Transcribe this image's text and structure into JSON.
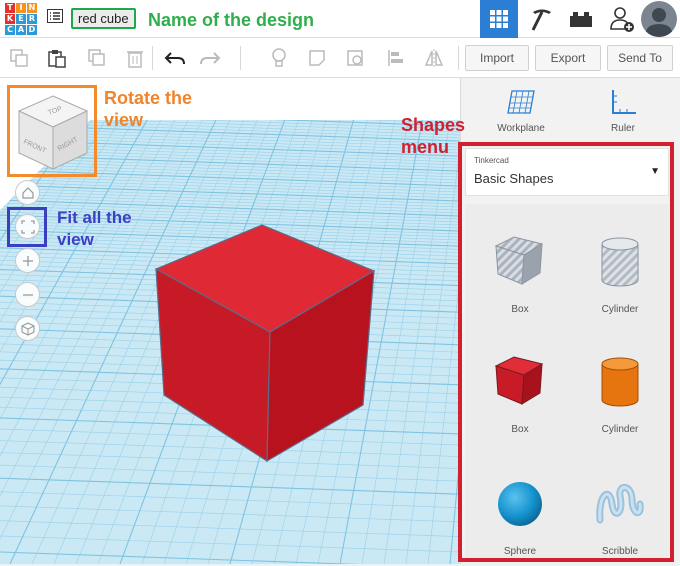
{
  "logo": {
    "letters": [
      "T",
      "I",
      "N",
      "K",
      "E",
      "R",
      "C",
      "A",
      "D"
    ]
  },
  "header": {
    "design_name": "red cube",
    "design_name_callout": "Name of the design"
  },
  "toolbar": {
    "import_label": "Import",
    "export_label": "Export",
    "send_to_label": "Send To",
    "icons": [
      "copy-icon",
      "paste-icon",
      "duplicate-icon",
      "delete-icon",
      "undo-icon",
      "redo-icon",
      "lightbulb-icon",
      "shape-note-icon",
      "note-icon",
      "align-icon",
      "mirror-icon"
    ]
  },
  "viewcube": {
    "top": "TOP",
    "front": "FRONT",
    "right": "RIGHT"
  },
  "callouts": {
    "rotate": "Rotate the view",
    "fit_all": "Fit all the view",
    "shapes_menu": "Shapes menu"
  },
  "right_panel": {
    "workplane_label": "Workplane",
    "ruler_label": "Ruler",
    "library_source": "Tinkercad",
    "library_name": "Basic Shapes",
    "shapes": [
      {
        "name": "Box",
        "icon": "box-hole-icon"
      },
      {
        "name": "Cylinder",
        "icon": "cylinder-hole-icon"
      },
      {
        "name": "Box",
        "icon": "box-solid-icon"
      },
      {
        "name": "Cylinder",
        "icon": "cylinder-solid-icon"
      },
      {
        "name": "Sphere",
        "icon": "sphere-icon"
      },
      {
        "name": "Scribble",
        "icon": "scribble-icon"
      }
    ]
  },
  "colors": {
    "accent_blue": "#2a7fd4",
    "cube_red": "#d61e2a",
    "callout_green": "#2fae4d",
    "callout_orange": "#f0842a",
    "callout_blue": "#3a3fc4",
    "callout_red": "#d2202e",
    "grid_blue": "#a9d9ee"
  }
}
